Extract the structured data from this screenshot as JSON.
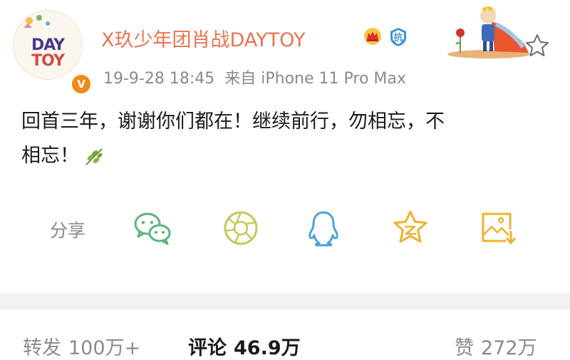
{
  "post": {
    "avatar_text_line1": "DAY",
    "avatar_text_line2": "TOY",
    "verified_mark": "V",
    "username": "X玖少年团肖战DAYTOY",
    "timestamp": "19-9-28 18:45",
    "source": "来自 iPhone 11 Pro Max",
    "content_line1": "回首三年，谢谢你们都在！继续前行，勿相忘，不",
    "content_line2": "相忘！",
    "badges": [
      "crown-icon",
      "kang-badge-icon"
    ],
    "kang_text": "抗"
  },
  "share": {
    "label": "分享",
    "items": [
      "wechat-icon",
      "moments-icon",
      "qq-icon",
      "qzone-icon",
      "save-image-icon"
    ]
  },
  "tabs": {
    "repost_label": "转发",
    "repost_count": "100万+",
    "comment_label": "评论",
    "comment_count": "46.9万",
    "like_label": "赞",
    "like_count": "272万"
  },
  "colors": {
    "username": "#eb7350",
    "meta": "#8a8a8a",
    "share_green": "#5bb57a",
    "share_blue": "#4aa3df",
    "share_yellow": "#f0b12c"
  }
}
